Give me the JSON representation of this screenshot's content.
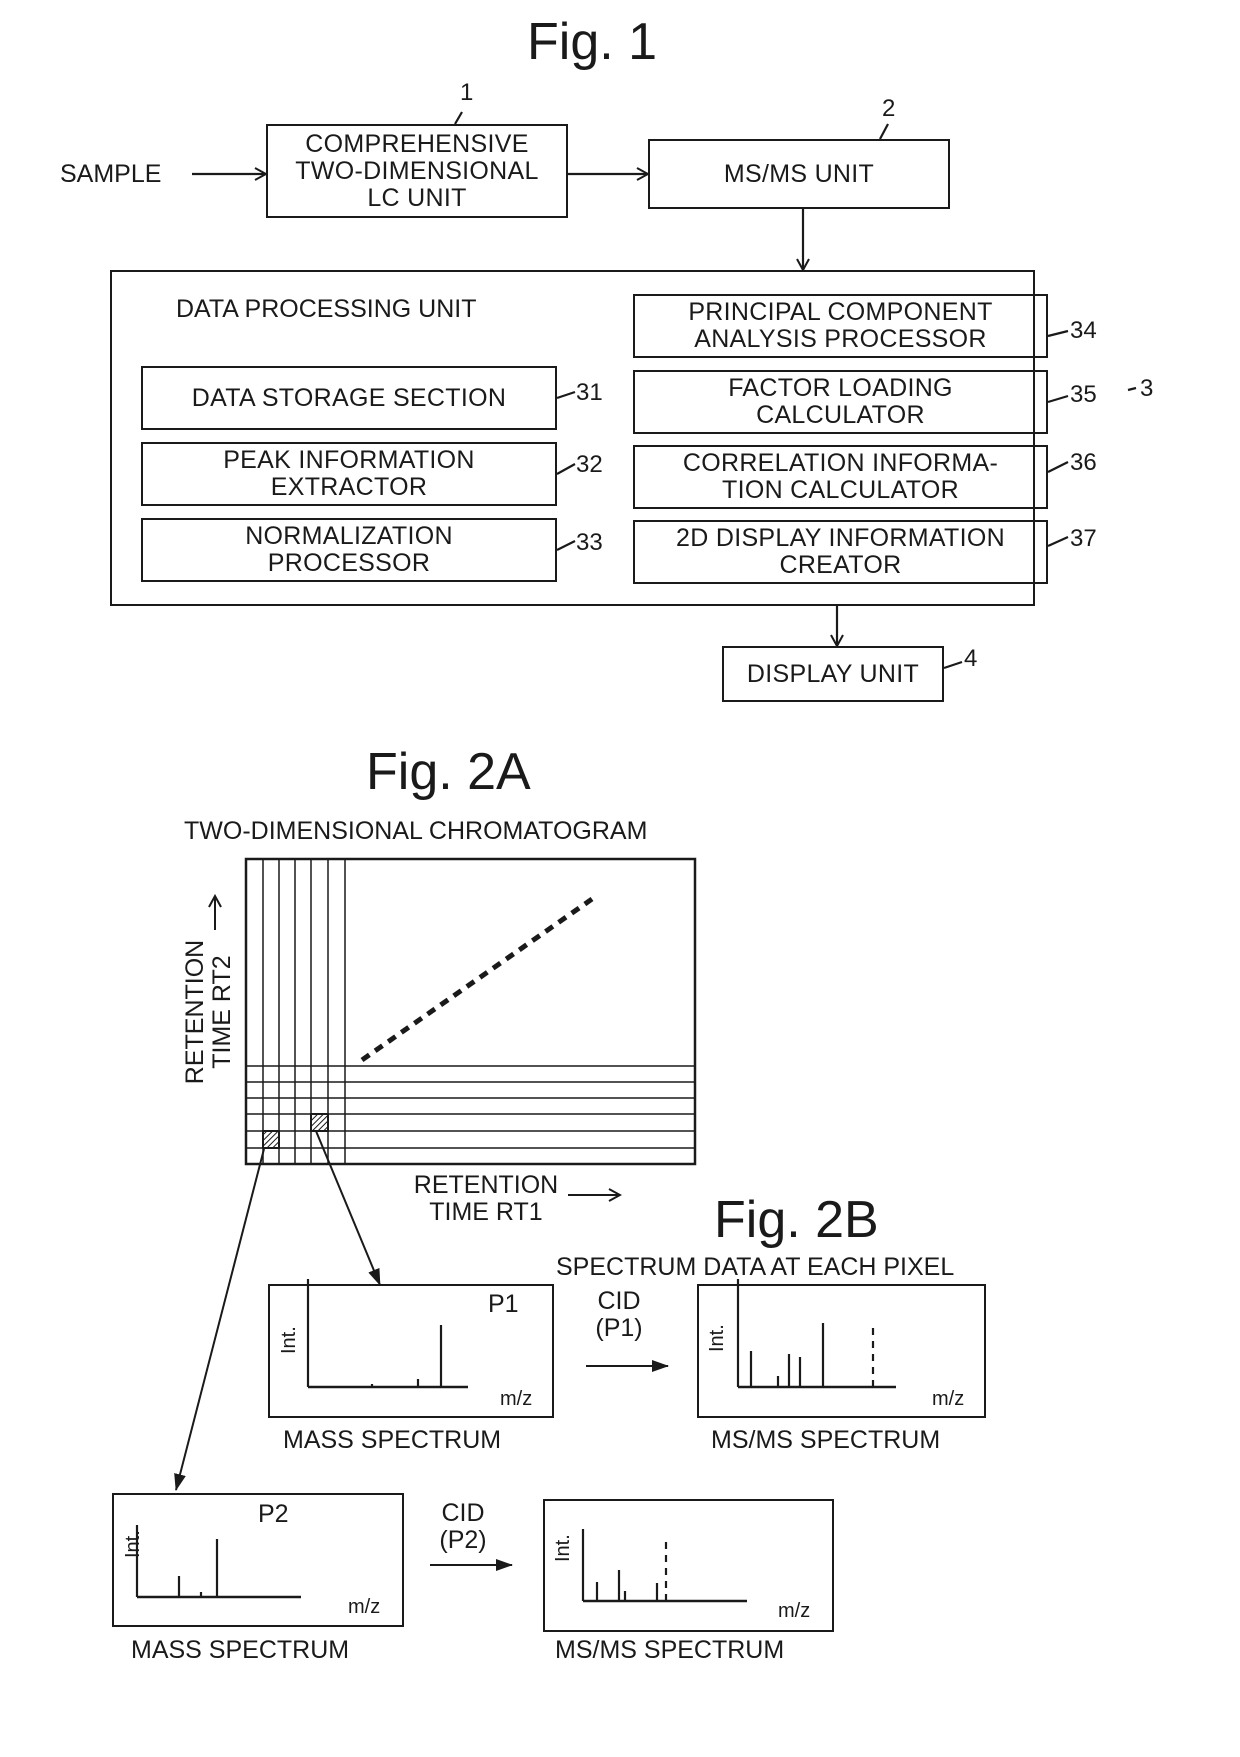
{
  "fig1": {
    "title": "Fig. 1",
    "sample_label": "SAMPLE",
    "lc_unit": {
      "ref": "1",
      "lines": [
        "COMPREHENSIVE",
        "TWO-DIMENSIONAL",
        "LC UNIT"
      ]
    },
    "msms_unit": {
      "ref": "2",
      "label": "MS/MS UNIT"
    },
    "data_processing_unit": {
      "ref": "3",
      "label": "DATA PROCESSING UNIT",
      "left_blocks": [
        {
          "ref": "31",
          "lines": [
            "DATA STORAGE SECTION"
          ]
        },
        {
          "ref": "32",
          "lines": [
            "PEAK INFORMATION",
            "EXTRACTOR"
          ]
        },
        {
          "ref": "33",
          "lines": [
            "NORMALIZATION",
            "PROCESSOR"
          ]
        }
      ],
      "right_blocks": [
        {
          "ref": "34",
          "lines": [
            "PRINCIPAL COMPONENT",
            "ANALYSIS PROCESSOR"
          ]
        },
        {
          "ref": "35",
          "lines": [
            "FACTOR LOADING",
            "CALCULATOR"
          ]
        },
        {
          "ref": "36",
          "lines": [
            "CORRELATION INFORMA-",
            "TION CALCULATOR"
          ]
        },
        {
          "ref": "37",
          "lines": [
            "2D DISPLAY INFORMATION",
            "CREATOR"
          ]
        }
      ]
    },
    "display_unit": {
      "ref": "4",
      "label": "DISPLAY UNIT"
    }
  },
  "fig2a": {
    "title": "Fig. 2A",
    "subtitle": "TWO-DIMENSIONAL CHROMATOGRAM",
    "y_axis": [
      "RETENTION",
      "TIME RT2"
    ],
    "x_axis": [
      "RETENTION",
      "TIME RT1"
    ]
  },
  "fig2b": {
    "title": "Fig. 2B",
    "subtitle": "SPECTRUM DATA AT EACH PIXEL",
    "int_label": "Int.",
    "mz_label": "m/z",
    "row1": {
      "mass": {
        "peak_label": "P1",
        "caption": "MASS SPECTRUM"
      },
      "cid": [
        "CID",
        "(P1)"
      ],
      "msms": {
        "caption": "MS/MS SPECTRUM"
      }
    },
    "row2": {
      "mass": {
        "peak_label": "P2",
        "caption": "MASS SPECTRUM"
      },
      "cid": [
        "CID",
        "(P2)"
      ],
      "msms": {
        "caption": "MS/MS SPECTRUM"
      }
    }
  }
}
